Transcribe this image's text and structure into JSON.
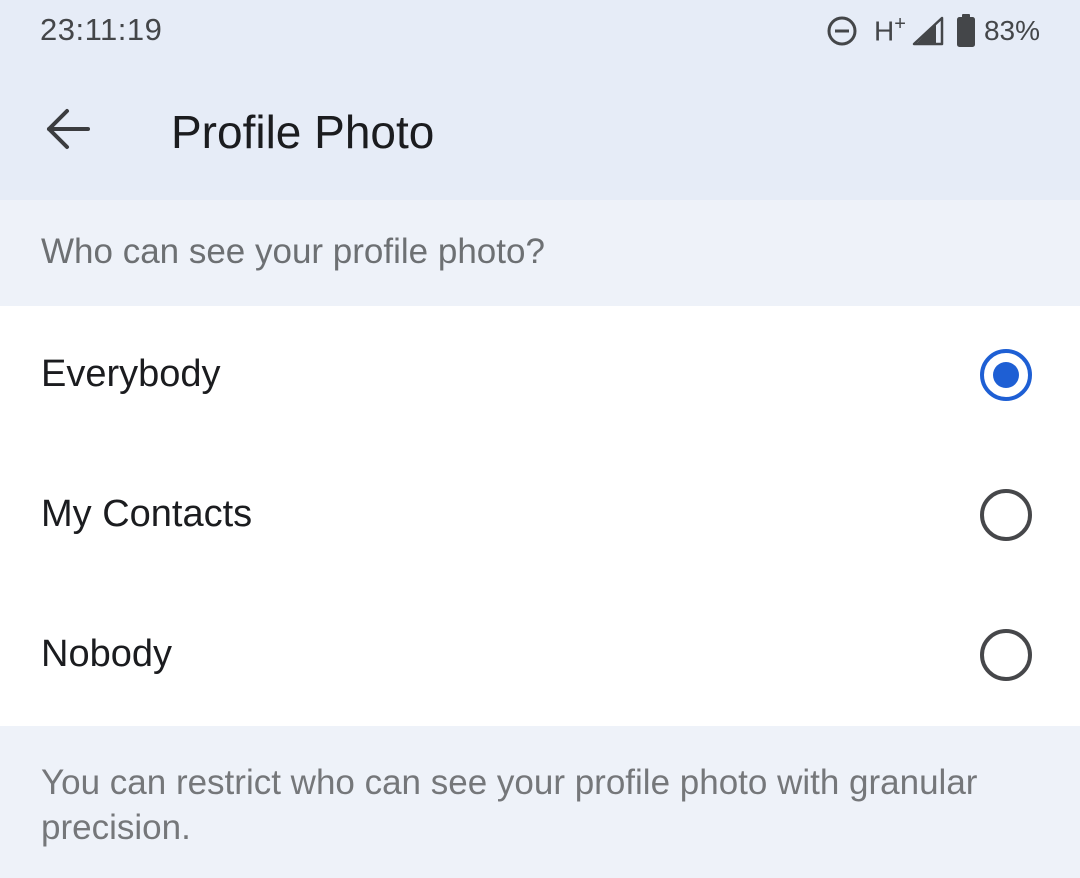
{
  "status_bar": {
    "time": "23:11:19",
    "network_type": "H",
    "network_superscript": "+",
    "battery_percent": "83%",
    "icons": [
      "do-not-disturb-icon",
      "signal-icon",
      "battery-icon"
    ]
  },
  "app_bar": {
    "back_icon": "arrow-left-icon",
    "title": "Profile Photo"
  },
  "section": {
    "header": "Who can see your profile photo?"
  },
  "options": [
    {
      "label": "Everybody",
      "selected": true
    },
    {
      "label": "My Contacts",
      "selected": false
    },
    {
      "label": "Nobody",
      "selected": false
    }
  ],
  "footer": {
    "text": "You can restrict who can see your profile photo with granular precision."
  },
  "colors": {
    "accent": "#1e5fd4",
    "app_bar_bg": "#e6ecf7",
    "section_bg": "#eef2f9",
    "list_bg": "#ffffff"
  }
}
